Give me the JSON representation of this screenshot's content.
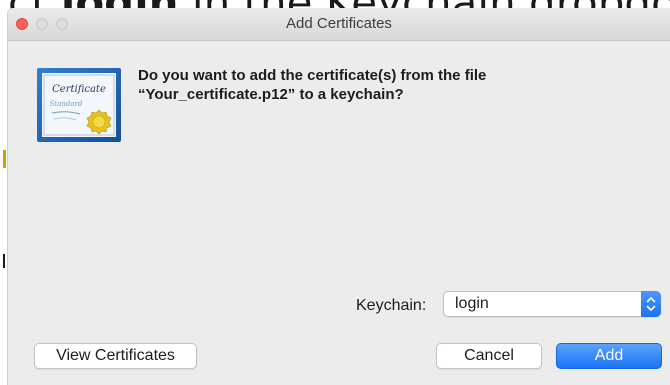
{
  "background_caption": {
    "prefix": "ct ",
    "bold": "login",
    "suffix": " in the Keychain dropdown menu"
  },
  "window": {
    "title": "Add Certificates"
  },
  "icon": {
    "name": "certificate-icon",
    "line1": "Certificate",
    "line2": "Standard"
  },
  "message": {
    "line1": "Do you want to add the certificate(s) from the file",
    "line2": "“Your_certificate.p12” to a keychain?"
  },
  "keychain": {
    "label": "Keychain:",
    "selected": "login"
  },
  "buttons": {
    "view_certificates": "View Certificates",
    "cancel": "Cancel",
    "add": "Add"
  },
  "colors": {
    "accent": "#1b74f2",
    "close_light": "#fc605c",
    "certificate_border": "#1c5fa8",
    "seal": "#e6c21f"
  }
}
